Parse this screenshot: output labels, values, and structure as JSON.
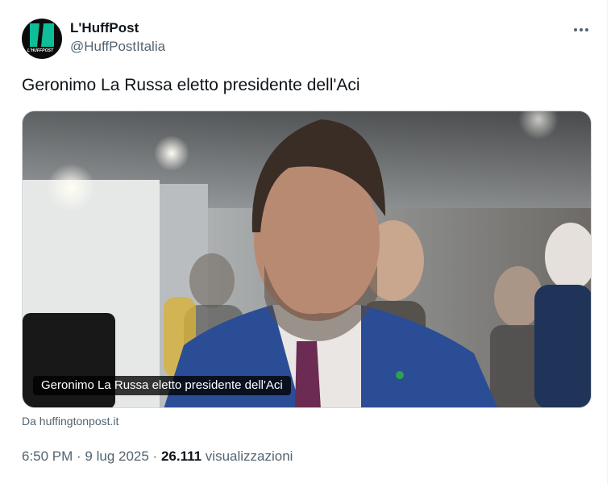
{
  "tweet": {
    "author": {
      "display_name": "L'HuffPost",
      "handle": "@HuffPostItalia",
      "avatar_logo_text": "L'HUFFPOST"
    },
    "more_icon": "more-horizontal-icon",
    "text": "Geronimo La Russa eletto presidente dell'Aci",
    "card": {
      "caption": "Geronimo La Russa eletto presidente dell'Aci",
      "source": "Da huffingtonpost.it"
    },
    "meta": {
      "time": "6:50 PM",
      "separator": " · ",
      "date": "9 lug 2025",
      "views_count": "26.111",
      "views_label": " visualizzazioni"
    }
  },
  "colors": {
    "text_primary": "#0f1419",
    "text_secondary": "#536471",
    "brand_green": "#0dbe98",
    "border": "#cfd9de"
  }
}
